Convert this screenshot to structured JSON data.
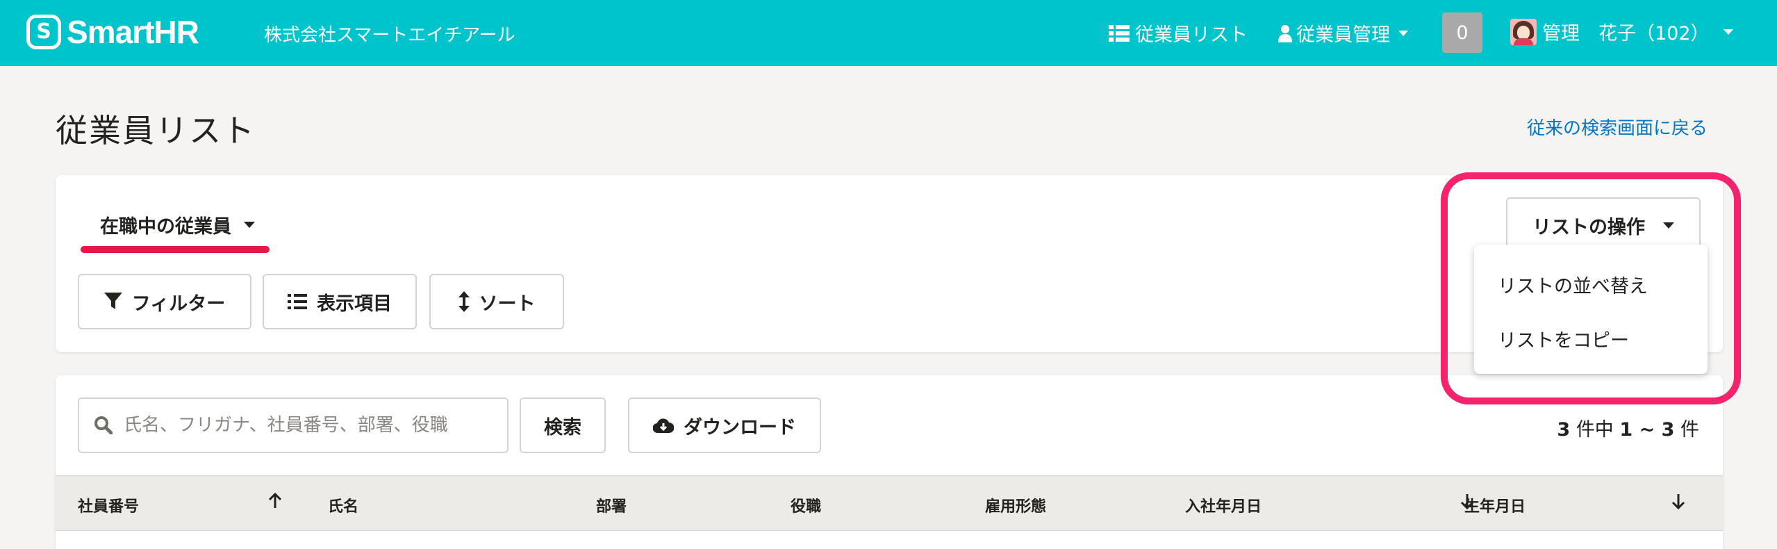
{
  "header": {
    "logo_mark": "S",
    "logo_text": "SmartHR",
    "company": "株式会社スマートエイチアール",
    "nav_list": "従業員リスト",
    "nav_manage": "従業員管理",
    "notifications": "0",
    "user": "管理　花子（102）"
  },
  "page": {
    "title": "従業員リスト",
    "back_link": "従来の検索画面に戻る"
  },
  "filter_card": {
    "active_tab": "在職中の従業員",
    "buttons": {
      "filter": "フィルター",
      "columns": "表示項目",
      "sort": "ソート"
    },
    "list_ops": "リストの操作",
    "menu": [
      "リストの並べ替え",
      "リストをコピー"
    ]
  },
  "search": {
    "placeholder": "氏名、フリガナ、社員番号、部署、役職",
    "search_button": "検索",
    "download_button": "ダウンロード",
    "count_prefix": "3",
    "count_mid": "件中",
    "count_range": "1 ~ 3",
    "count_suffix": "件"
  },
  "table": {
    "columns": [
      "社員番号",
      "氏名",
      "部署",
      "役職",
      "雇用形態",
      "入社年月日",
      "生年月日"
    ]
  },
  "colors": {
    "header_bg": "#00c4cc",
    "highlight": "#f5226c",
    "tab_underline": "#e8174a",
    "link": "#0077c7"
  }
}
